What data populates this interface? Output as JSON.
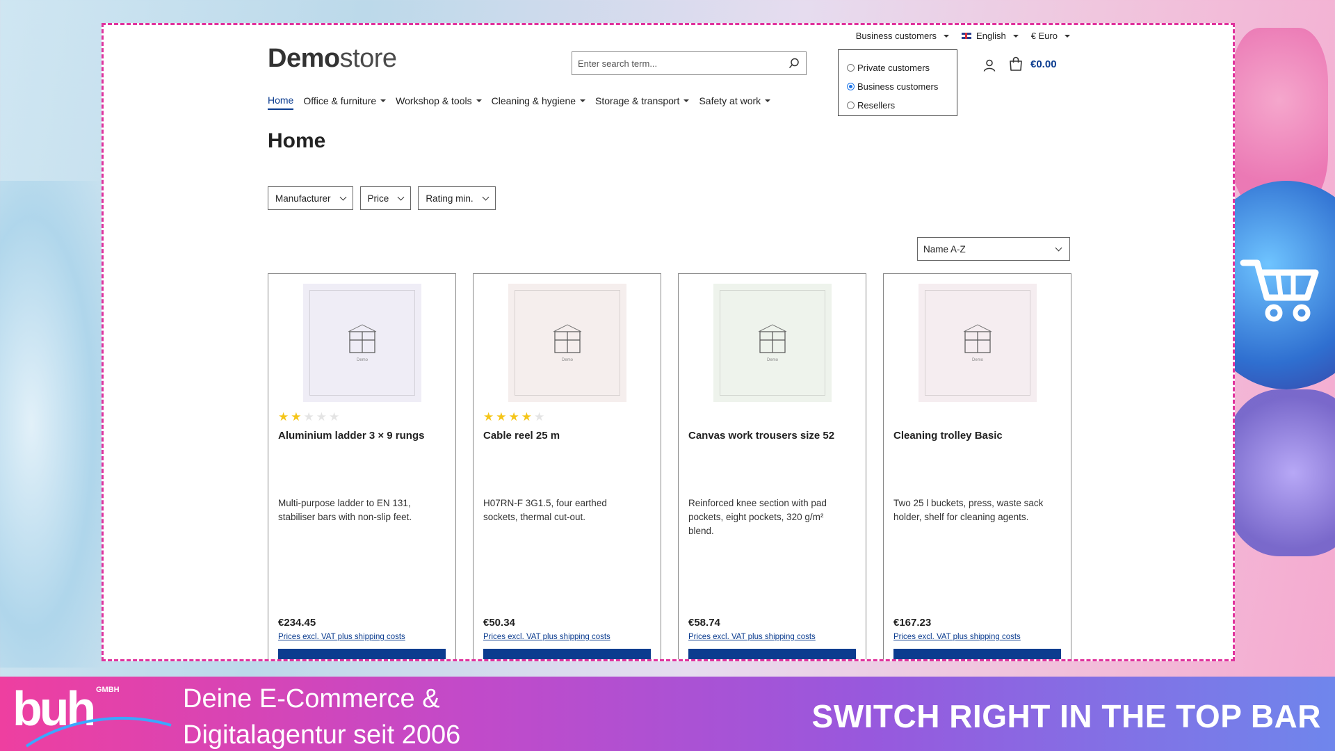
{
  "topbar": {
    "customer_type": "Business customers",
    "language": "English",
    "currency": "€ Euro"
  },
  "logo": {
    "bold": "Demo",
    "light": "store"
  },
  "search": {
    "placeholder": "Enter search term..."
  },
  "customer_popup": {
    "options": [
      {
        "label": "Private customers",
        "checked": false
      },
      {
        "label": "Business customers",
        "checked": true
      },
      {
        "label": "Resellers",
        "checked": false
      }
    ]
  },
  "cart": {
    "amount": "€0.00"
  },
  "nav": {
    "items": [
      {
        "label": "Home",
        "active": true
      },
      {
        "label": "Office & furniture"
      },
      {
        "label": "Workshop & tools"
      },
      {
        "label": "Cleaning & hygiene"
      },
      {
        "label": "Storage & transport"
      },
      {
        "label": "Safety at work"
      }
    ]
  },
  "page_title": "Home",
  "filters": [
    "Manufacturer",
    "Price",
    "Rating min."
  ],
  "sort": {
    "selected": "Name A-Z"
  },
  "products": [
    {
      "name": "Aluminium ladder 3 × 9 rungs",
      "rating": 2,
      "description": "Multi-purpose ladder to EN 131, stabiliser bars with non-slip feet.",
      "price": "€234.45",
      "vat_note": "Prices excl. VAT plus shipping costs",
      "image_tint": "#efedf6",
      "image_text": "Demo"
    },
    {
      "name": "Cable reel 25 m",
      "rating": 4,
      "description": "H07RN-F 3G1.5, four earthed sockets, thermal cut-out.",
      "price": "€50.34",
      "vat_note": "Prices excl. VAT plus shipping costs",
      "image_tint": "#f5eeed",
      "image_text": "Demo"
    },
    {
      "name": "Canvas work trousers size 52",
      "rating": 0,
      "description": "Reinforced knee section with pad pockets, eight pockets, 320 g/m² blend.",
      "price": "€58.74",
      "vat_note": "Prices excl. VAT plus shipping costs",
      "image_tint": "#eef3ec",
      "image_text": "Demo"
    },
    {
      "name": "Cleaning trolley Basic",
      "rating": 0,
      "description": "Two 25 l buckets, press, waste sack holder, shelf for cleaning agents.",
      "price": "€167.23",
      "vat_note": "Prices excl. VAT plus shipping costs",
      "image_tint": "#f5edf0",
      "image_text": "Demo"
    }
  ],
  "banner": {
    "brand": "buh",
    "brand_suffix": "GMBH",
    "tagline_1": "Deine E-Commerce &",
    "tagline_2": "Digitalagentur seit 2006",
    "cta": "SWITCH RIGHT IN THE TOP BAR"
  },
  "colors": {
    "accent": "#0b3c8f",
    "frame": "#e0339d",
    "star": "#f5c518"
  }
}
